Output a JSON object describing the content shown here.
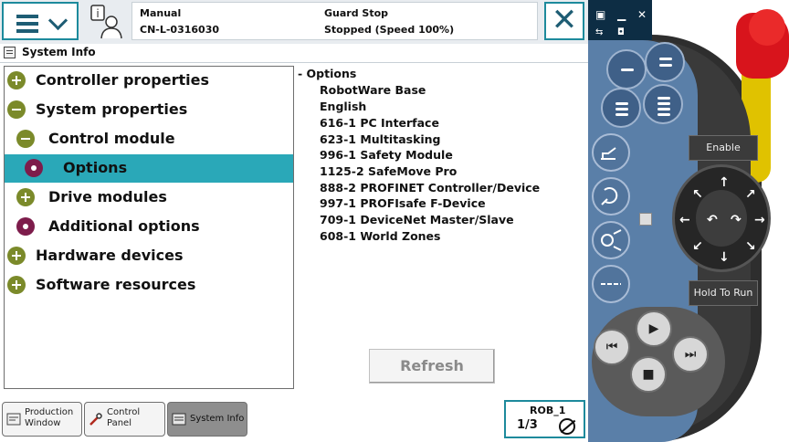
{
  "header": {
    "mode": "Manual",
    "controller": "CN-L-0316030",
    "safety_state": "Guard Stop",
    "run_state": "Stopped (Speed 100%)",
    "close_glyph": "✕",
    "menu_icon": "hamburger-menu-icon",
    "status_icon": "operator-info-icon"
  },
  "window": {
    "title": "System Info"
  },
  "tree": {
    "items": [
      {
        "label": "Controller properties",
        "expander": "plus"
      },
      {
        "label": "System properties",
        "expander": "minus"
      },
      {
        "label": "Control module",
        "expander": "minus"
      },
      {
        "label": "Options",
        "expander": "leaf",
        "selected": true
      },
      {
        "label": "Drive modules",
        "expander": "plus"
      },
      {
        "label": "Additional options",
        "expander": "leaf"
      },
      {
        "label": "Hardware devices",
        "expander": "plus"
      },
      {
        "label": "Software resources",
        "expander": "plus"
      }
    ]
  },
  "options": {
    "heading": "- Options",
    "items": [
      "RobotWare Base",
      "English",
      "616-1 PC Interface",
      "623-1 Multitasking",
      "996-1 Safety Module",
      "1125-2 SafeMove Pro",
      "888-2 PROFINET Controller/Device",
      "997-1 PROFIsafe F-Device",
      "709-1 DeviceNet Master/Slave",
      "608-1 World Zones"
    ]
  },
  "refresh_label": "Refresh",
  "taskbar": {
    "tasks": [
      {
        "label": "Production Window",
        "icon": "production-window-icon"
      },
      {
        "label": "Control Panel",
        "icon": "wrench-icon"
      },
      {
        "label": "System Info",
        "icon": "system-info-icon",
        "active": true
      }
    ],
    "rob": {
      "label": "ROB_1",
      "ratio": "1/3"
    }
  },
  "pendant": {
    "enable_label": "Enable",
    "hold_to_run_label": "Hold To Run"
  },
  "colors": {
    "selection": "#2aa8b8",
    "accent_border": "#1d8a9c",
    "expander_green": "#7b8a2a",
    "leaf_maroon": "#7d1c4b",
    "pendant_blue": "#5a7fa8",
    "emergency_red": "#d8141c"
  }
}
